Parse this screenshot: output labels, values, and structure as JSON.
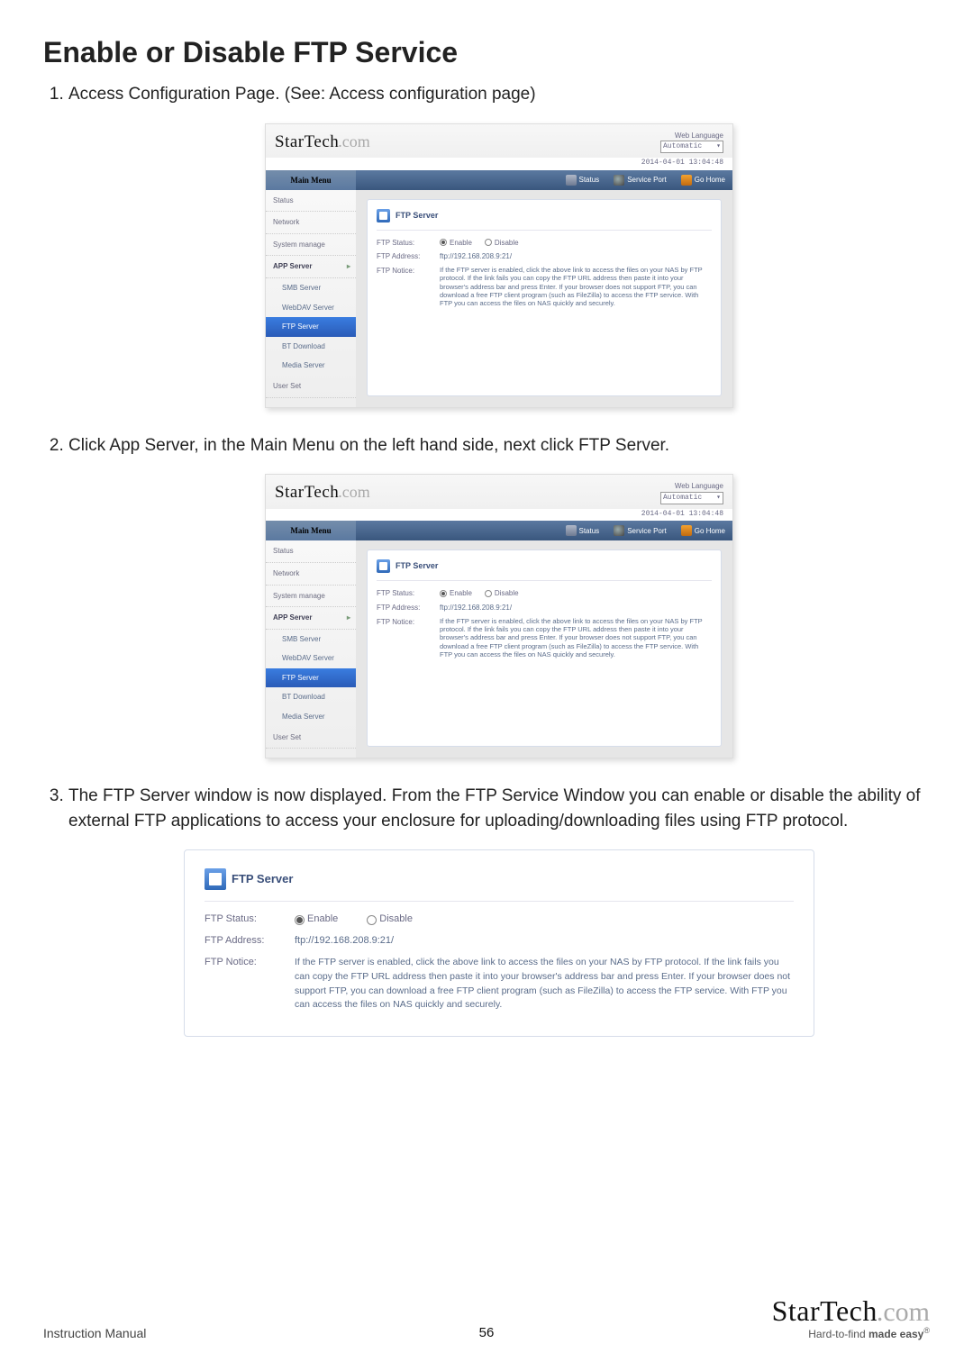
{
  "title": "Enable or Disable FTP Service",
  "steps": [
    "Access Configuration Page. (See: Access configuration page)",
    "Click App Server, in the Main Menu on the left hand side, next click FTP Server.",
    "The FTP Server window is now displayed.  From the FTP Service Window you can enable or disable the ability of external FTP applications to access your enclosure for uploading/downloading files using FTP protocol."
  ],
  "app": {
    "brand1": "StarTech",
    "brand2": ".com",
    "lang_label": "Web Language",
    "lang_value": "Automatic",
    "timestamp": "2014-04-01 13:04:48",
    "main_menu_label": "Main Menu",
    "tabs": {
      "status": "Status",
      "service": "Service Port",
      "home": "Go Home"
    },
    "menu": {
      "status": "Status",
      "network": "Network",
      "system": "System manage",
      "app_server": "APP Server",
      "smb": "SMB Server",
      "webdav": "WebDAV Server",
      "ftp": "FTP Server",
      "bt": "BT Download",
      "media": "Media Server",
      "user": "User Set"
    }
  },
  "ftp": {
    "header": "FTP Server",
    "status_label": "FTP Status:",
    "enable": "Enable",
    "disable": "Disable",
    "address_label": "FTP Address:",
    "address": "ftp://192.168.208.9:21/",
    "notice_label": "FTP Notice:",
    "notice": "If the FTP server is enabled, click the above link to access the files on your NAS by FTP protocol. If the link fails you can copy the FTP URL address then paste it into your browser's address bar and press Enter. If your browser does not support FTP, you can download a free FTP client program (such as FileZilla) to access the FTP service. With FTP you can access the files on NAS quickly and securely."
  },
  "footer": {
    "left": "Instruction Manual",
    "page": "56",
    "tagline_a": "Hard-to-find ",
    "tagline_b": "made easy",
    "reg": "®"
  }
}
